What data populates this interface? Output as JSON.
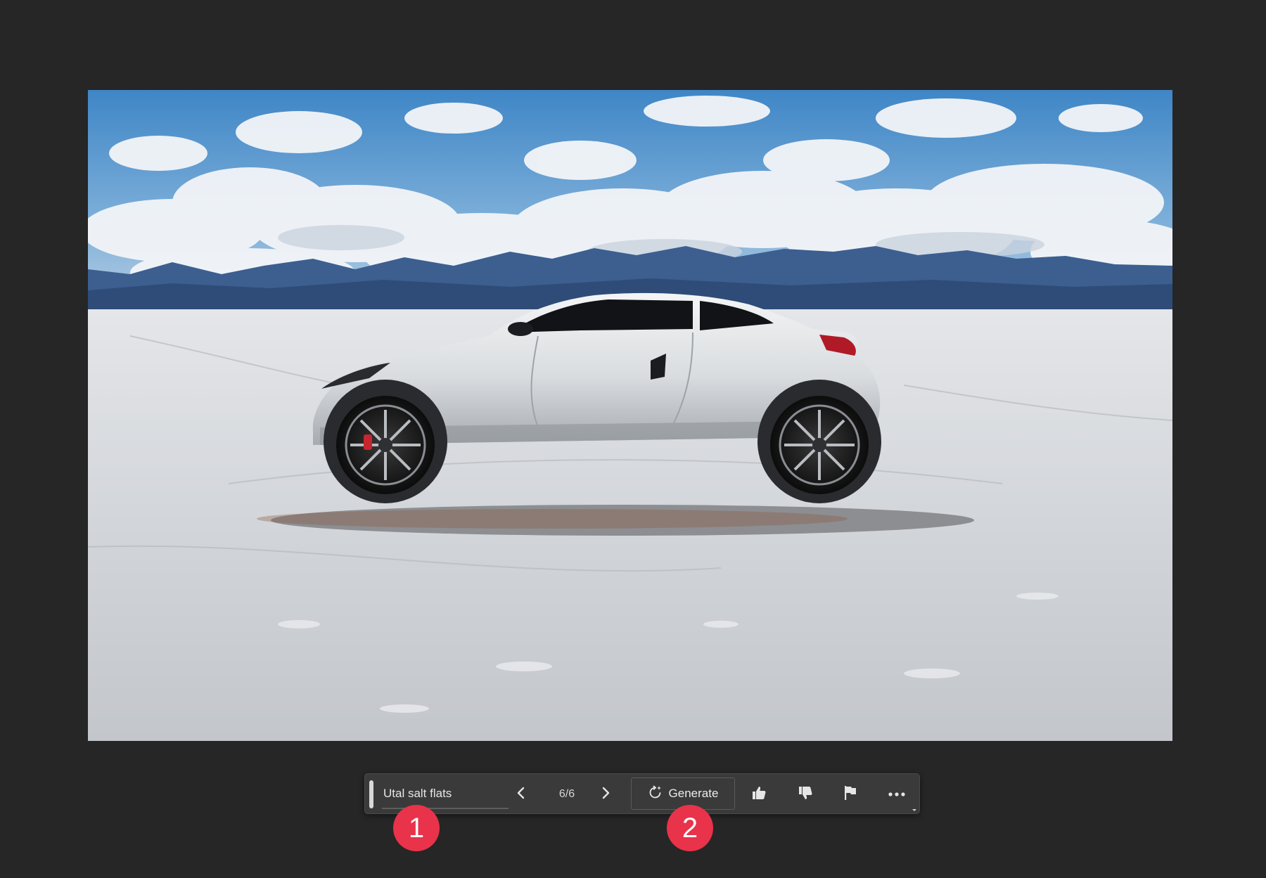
{
  "canvas": {
    "image_subject": "white sports car on salt flats"
  },
  "taskbar": {
    "prompt_text": "Utal salt flats",
    "prev_icon": "chevron-left-icon",
    "counter": "6/6",
    "next_icon": "chevron-right-icon",
    "generate_label": "Generate",
    "generate_icon": "regenerate-sparkle-icon",
    "like_icon": "thumbs-up-icon",
    "dislike_icon": "thumbs-down-icon",
    "report_icon": "flag-icon",
    "more_icon": "more-horizontal-icon"
  },
  "callouts": {
    "first": "1",
    "second": "2"
  },
  "colors": {
    "background": "#262626",
    "taskbar": "#3a3a3a",
    "badge": "#e8334a"
  }
}
